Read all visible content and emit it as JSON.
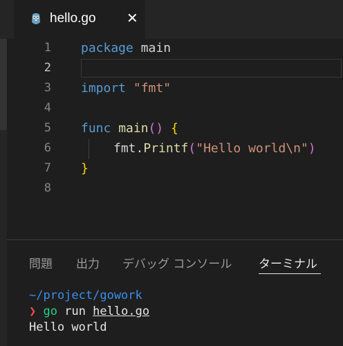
{
  "tab": {
    "title": "hello.go",
    "close": "✕"
  },
  "editor": {
    "line_numbers": [
      "1",
      "2",
      "3",
      "4",
      "5",
      "6",
      "7",
      "8"
    ],
    "active_line": "2",
    "code": {
      "l1_kw": "package",
      "l1_rest": " main",
      "l3_kw": "import",
      "l3_str": " \"fmt\"",
      "l5_kw": "func",
      "l5_fn": " main",
      "l5_paren": "()",
      "l5_brace": " {",
      "l6_obj": "fmt.",
      "l6_fn": "Printf",
      "l6_open": "(",
      "l6_str": "\"Hello world\\n\"",
      "l6_close": ")",
      "l7_brace": "}"
    }
  },
  "panel": {
    "tabs": [
      "問題",
      "出力",
      "デバッグ コンソール",
      "ターミナル"
    ],
    "active_tab": "ターミナル"
  },
  "terminal": {
    "path": "~/project/gowork",
    "prompt": "❯",
    "command": "go",
    "args_plain": " run ",
    "args_file": "hello.go",
    "output": "Hello world"
  },
  "colors": {
    "background": "#1e1e1e",
    "keyword": "#569cd6",
    "function": "#dcdcaa",
    "string": "#ce9178",
    "bracket": "#ffd700",
    "terminal_path": "#3b8eea",
    "terminal_prompt": "#f14c4c",
    "terminal_command": "#23d18b"
  }
}
